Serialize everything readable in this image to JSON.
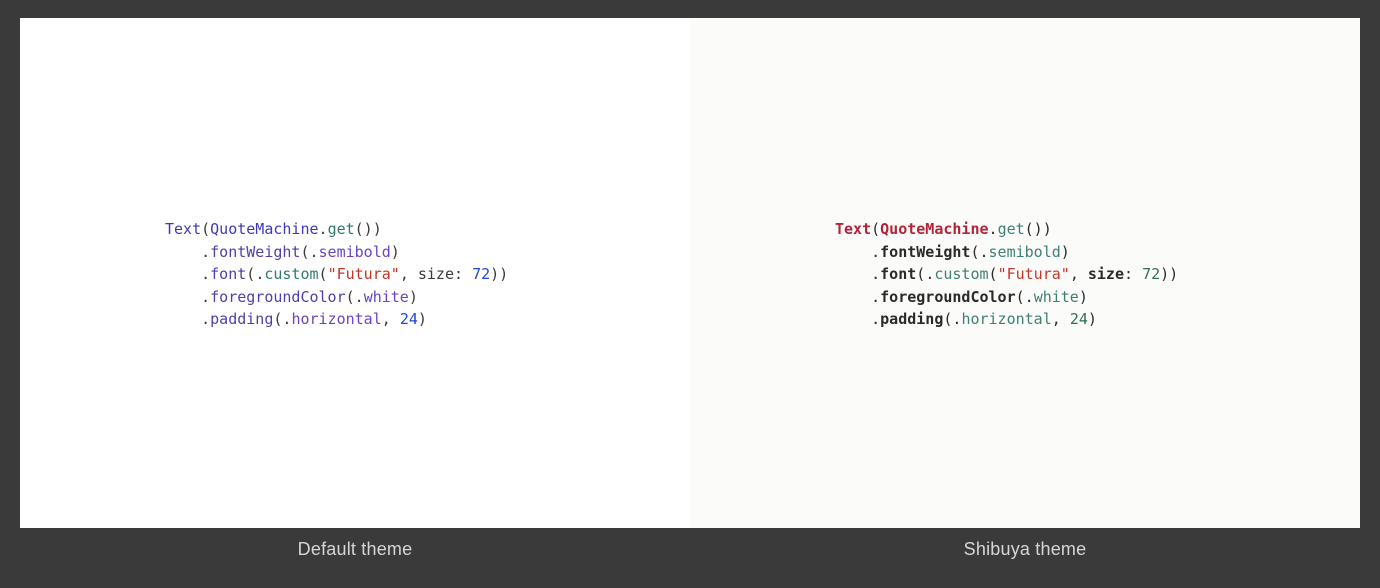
{
  "labels": {
    "left": "Default theme",
    "right": "Shibuya theme"
  },
  "code": {
    "line1": {
      "fn": "Text",
      "p_open": "(",
      "obj": "QuoteMachine",
      "dot": ".",
      "call": "get",
      "empty": "()",
      "p_close": ")"
    },
    "line2": {
      "indent": "    ",
      "dot": ".",
      "mod": "fontWeight",
      "p_open": "(",
      "edot": ".",
      "enum": "semibold",
      "p_close": ")"
    },
    "line3": {
      "indent": "    ",
      "dot": ".",
      "mod": "font",
      "p_open": "(",
      "edot": ".",
      "call": "custom",
      "p2_open": "(",
      "str": "\"Futura\"",
      "comma": ", ",
      "arg": "size",
      "colon": ": ",
      "num": "72",
      "p2_close": ")",
      "p_close": ")"
    },
    "line4": {
      "indent": "    ",
      "dot": ".",
      "mod": "foregroundColor",
      "p_open": "(",
      "edot": ".",
      "enum": "white",
      "p_close": ")"
    },
    "line5": {
      "indent": "    ",
      "dot": ".",
      "mod": "padding",
      "p_open": "(",
      "edot": ".",
      "enum": "horizontal",
      "comma": ", ",
      "num": "24",
      "p_close": ")"
    }
  }
}
